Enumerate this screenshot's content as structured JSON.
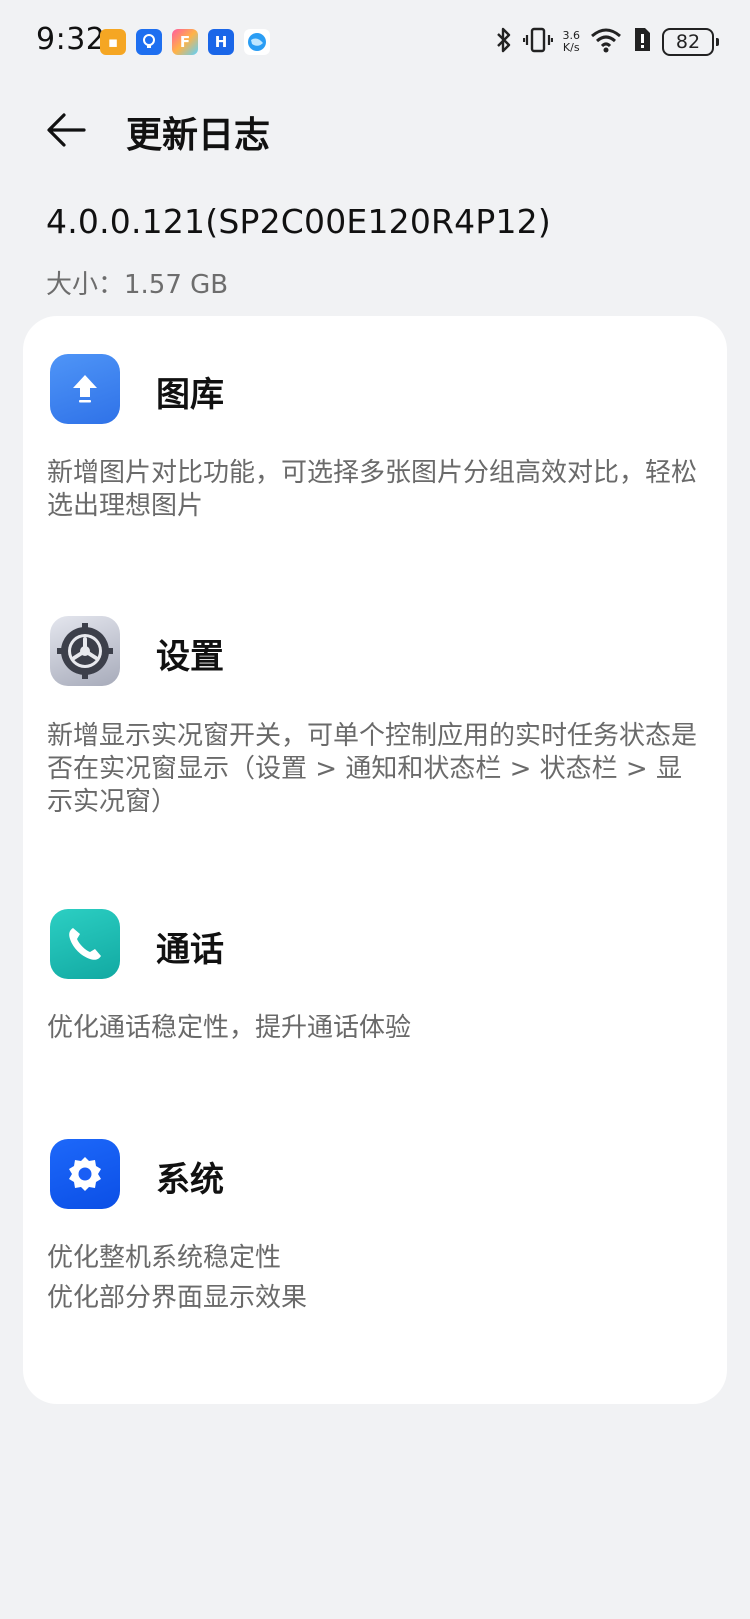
{
  "status_bar": {
    "time": "9:32",
    "net_speed_top": "3.6",
    "net_speed_bottom": "K/s",
    "battery": "82"
  },
  "header": {
    "title": "更新日志"
  },
  "update": {
    "version": "4.0.0.121(SP2C00E120R4P12)",
    "size": "大小：1.57 GB"
  },
  "sections": [
    {
      "name": "图库",
      "icon": "gallery-icon",
      "color": "#3a82f0",
      "desc": "新增图片对比功能，可选择多张图片分组高效对比，轻松选出理想图片"
    },
    {
      "name": "设置",
      "icon": "settings-gear-icon",
      "color": "#7a7e8e",
      "desc": "新增显示实况窗开关，可单个控制应用的实时任务状态是否在实况窗显示（设置 > 通知和状态栏 > 状态栏 > 显示实况窗）"
    },
    {
      "name": "通话",
      "icon": "phone-icon",
      "color": "#1bb5ad",
      "desc": "优化通话稳定性，提升通话体验"
    },
    {
      "name": "系统",
      "icon": "system-gear-icon",
      "color": "#1a5ef5",
      "desc_lines": [
        "优化整机系统稳定性",
        "优化部分界面显示效果"
      ]
    }
  ]
}
